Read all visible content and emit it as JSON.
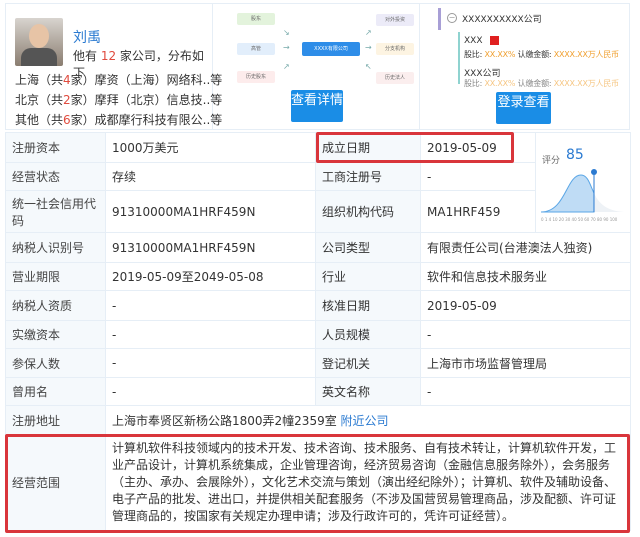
{
  "person": {
    "name": "刘禹",
    "count_prefix": "他有 ",
    "count": "12",
    "count_suffix": " 家公司，分布如下",
    "distribution": [
      {
        "pre": "上海（共",
        "n": "4",
        "post": "家）摩资（上海）网络科..等"
      },
      {
        "pre": "北京（共",
        "n": "2",
        "post": "家）摩拜（北京）信息技..等"
      },
      {
        "pre": "其他（共",
        "n": "6",
        "post": "家）成都摩行科技有限公..等"
      }
    ]
  },
  "diagram": {
    "left": [
      "股东",
      "高管",
      "历史股东"
    ],
    "center": "XXXX有限公司",
    "right": [
      "对外投资",
      "分支机构",
      "历史法人"
    ],
    "button": "查看详情"
  },
  "shareholder": {
    "company": "XXXXXXXXXX公司",
    "items": [
      {
        "name": "XXX",
        "ratio_label": "股比:",
        "ratio": "XX.XX%",
        "amount_label": "认缴金额:",
        "amount": "XXXX.XX万人民币"
      },
      {
        "name": "XXX公司",
        "ratio_label": "股比:",
        "ratio": "XX.XX%",
        "amount_label": "认缴金额:",
        "amount": "XXXX.XX万人民币"
      }
    ],
    "button": "登录查看"
  },
  "score": {
    "label": "评分",
    "value": "85",
    "ticks": [
      "0",
      "1",
      "4",
      "10",
      "20",
      "30",
      "40",
      "50",
      "60",
      "70",
      "80",
      "90",
      "100"
    ],
    "marker": 85
  },
  "rows": {
    "reg_capital": {
      "label": "注册资本",
      "value": "1000万美元"
    },
    "found_date": {
      "label": "成立日期",
      "value": "2019-05-09"
    },
    "status": {
      "label": "经营状态",
      "value": "存续"
    },
    "reg_no": {
      "label": "工商注册号",
      "value": "-"
    },
    "credit_code": {
      "label": "统一社会信用代码",
      "value": "91310000MA1HRF459N"
    },
    "org_code": {
      "label": "组织机构代码",
      "value": "MA1HRF459"
    },
    "tax_id": {
      "label": "纳税人识别号",
      "value": "91310000MA1HRF459N"
    },
    "company_type": {
      "label": "公司类型",
      "value": "有限责任公司(台港澳法人独资)"
    },
    "term": {
      "label": "营业期限",
      "value": "2019-05-09至2049-05-08"
    },
    "industry": {
      "label": "行业",
      "value": "软件和信息技术服务业"
    },
    "tax_quality": {
      "label": "纳税人资质",
      "value": "-"
    },
    "approve_date": {
      "label": "核准日期",
      "value": "2019-05-09"
    },
    "paid_capital": {
      "label": "实缴资本",
      "value": "-"
    },
    "staff_size": {
      "label": "人员规模",
      "value": "-"
    },
    "insured": {
      "label": "参保人数",
      "value": "-"
    },
    "authority": {
      "label": "登记机关",
      "value": "上海市市场监督管理局"
    },
    "former_name": {
      "label": "曾用名",
      "value": "-"
    },
    "en_name": {
      "label": "英文名称",
      "value": "-"
    },
    "address": {
      "label": "注册地址",
      "value": "上海市奉贤区新杨公路1800弄2幢2359室",
      "link": "附近公司"
    },
    "scope": {
      "label": "经营范围",
      "value": "计算机软件科技领域内的技术开发、技术咨询、技术服务、自有技术转让，计算机软件开发，工业产品设计，计算机系统集成，企业管理咨询，经济贸易咨询（金融信息服务除外），会务服务（主办、承办、会展除外），文化艺术交流与策划（演出经纪除外）；计算机、软件及辅助设备、电子产品的批发、进出口，并提供相关配套服务（不涉及国营贸易管理商品，涉及配额、许可证管理商品的，按国家有关规定办理申请；涉及行政许可的，凭许可证经营）。"
    }
  }
}
